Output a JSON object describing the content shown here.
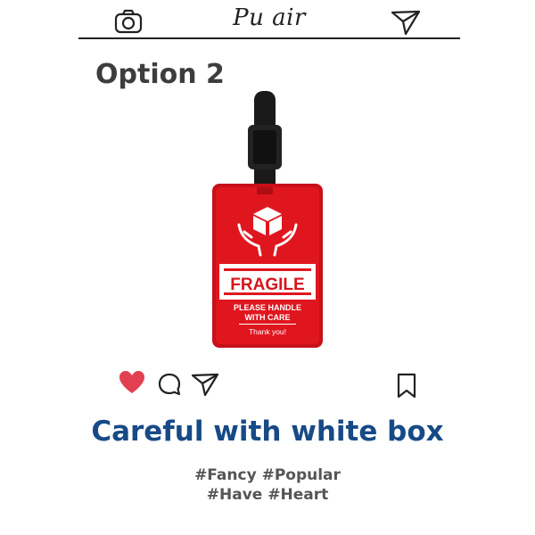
{
  "header": {
    "brand": "Pu air",
    "camera_icon": "camera-icon",
    "send_icon": "paper-plane-icon"
  },
  "post": {
    "option_label": "Option 2",
    "tag": {
      "fragile_text": "FRAGILE",
      "line1": "PLEASE HANDLE",
      "line2": "WITH CARE",
      "thanks": "Thank you!",
      "color": "#d8141a"
    },
    "actions": {
      "like_icon": "heart-icon",
      "like_color": "#e24050",
      "comment_icon": "comment-icon",
      "share_icon": "paper-plane-icon",
      "save_icon": "bookmark-icon"
    },
    "caption": "Careful with white box",
    "hashtags_line1": "#Fancy #Popular",
    "hashtags_line2": "#Have #Heart"
  }
}
